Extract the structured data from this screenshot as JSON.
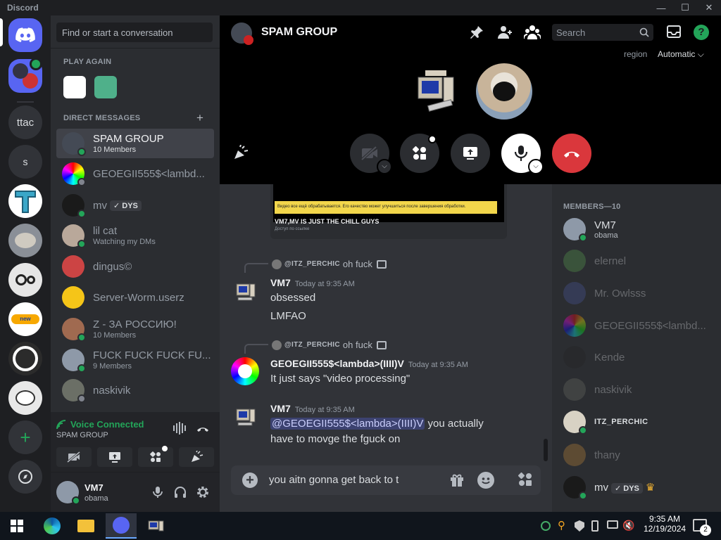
{
  "app": {
    "title": "Discord"
  },
  "window": {
    "minimize": "—",
    "maximize": "☐",
    "close": "✕"
  },
  "servers": {
    "ttac": "ttac",
    "s": "s"
  },
  "dm_search": {
    "placeholder": "Find or start a conversation"
  },
  "play_again": {
    "heading": "PLAY AGAIN"
  },
  "direct_messages": {
    "heading": "DIRECT MESSAGES",
    "add": "+"
  },
  "dms": [
    {
      "name": "SPAM GROUP",
      "sub": "10 Members"
    },
    {
      "name": "GEOEGII555$<lambd...",
      "sub": ""
    },
    {
      "name": "mv",
      "badge": "DYS",
      "sub": ""
    },
    {
      "name": "lil cat",
      "sub": "Watching my DMs"
    },
    {
      "name": "dingus©",
      "sub": ""
    },
    {
      "name": "Server-Worm.userz",
      "sub": ""
    },
    {
      "name": "Z - ЗА РОССИЮ!",
      "sub": "10 Members"
    },
    {
      "name": "FUCK FUCK FUCK FU...",
      "sub": "9 Members"
    },
    {
      "name": "naskivik",
      "sub": ""
    }
  ],
  "voice": {
    "status": "Voice Connected",
    "channel": "SPAM GROUP"
  },
  "user": {
    "name": "VM7",
    "tag": "obama"
  },
  "header": {
    "title": "SPAM GROUP",
    "search_placeholder": "Search",
    "region_label": "region",
    "region_value": "Automatic"
  },
  "embed": {
    "caption": "Видео все ещё обрабатывается. Его качество может улучшиться после завершения обработки.",
    "title": "VM7,MV IS JUST THE CHILL GUYS",
    "footer": "Доступ по ссылке"
  },
  "messages": [
    {
      "reply_name": "@ITZ_PERCHIC",
      "reply_text": "oh fuck",
      "author": "VM7",
      "time": "Today at 9:35 AM",
      "lines": [
        "obsessed",
        "LMFAO"
      ]
    },
    {
      "reply_name": "@ITZ_PERCHIC",
      "reply_text": "oh fuck",
      "author": "GEOEGII555$<lambda>(IIII)V",
      "time": "Today at 9:35 AM",
      "lines": [
        "It just says \"video processing\""
      ]
    },
    {
      "author": "VM7",
      "time": "Today at 9:35 AM",
      "mention": "@GEOEGII555$<lambda>(IIII)V",
      "line1_rest": " you actually",
      "line2": "have to movge the fguck on"
    }
  ],
  "composer": {
    "value": "you aitn gonna get back to t"
  },
  "members": {
    "heading": "MEMBERS—10",
    "list": [
      {
        "name": "VM7",
        "sub": "obama"
      },
      {
        "name": "elernel"
      },
      {
        "name": "Mr. Owlsss"
      },
      {
        "name": "GEOEGII555$<lambd..."
      },
      {
        "name": "Kende"
      },
      {
        "name": "naskivik"
      },
      {
        "name": "ITZ_PERCHIC"
      },
      {
        "name": "thany"
      },
      {
        "name": "mv",
        "badge": "DYS"
      }
    ]
  },
  "taskbar": {
    "time": "9:35 AM",
    "date": "12/19/2024",
    "notifications": "2"
  },
  "colors": {
    "accent": "#5865f2",
    "green": "#23a559",
    "red": "#da373c",
    "bg": "#313338"
  }
}
